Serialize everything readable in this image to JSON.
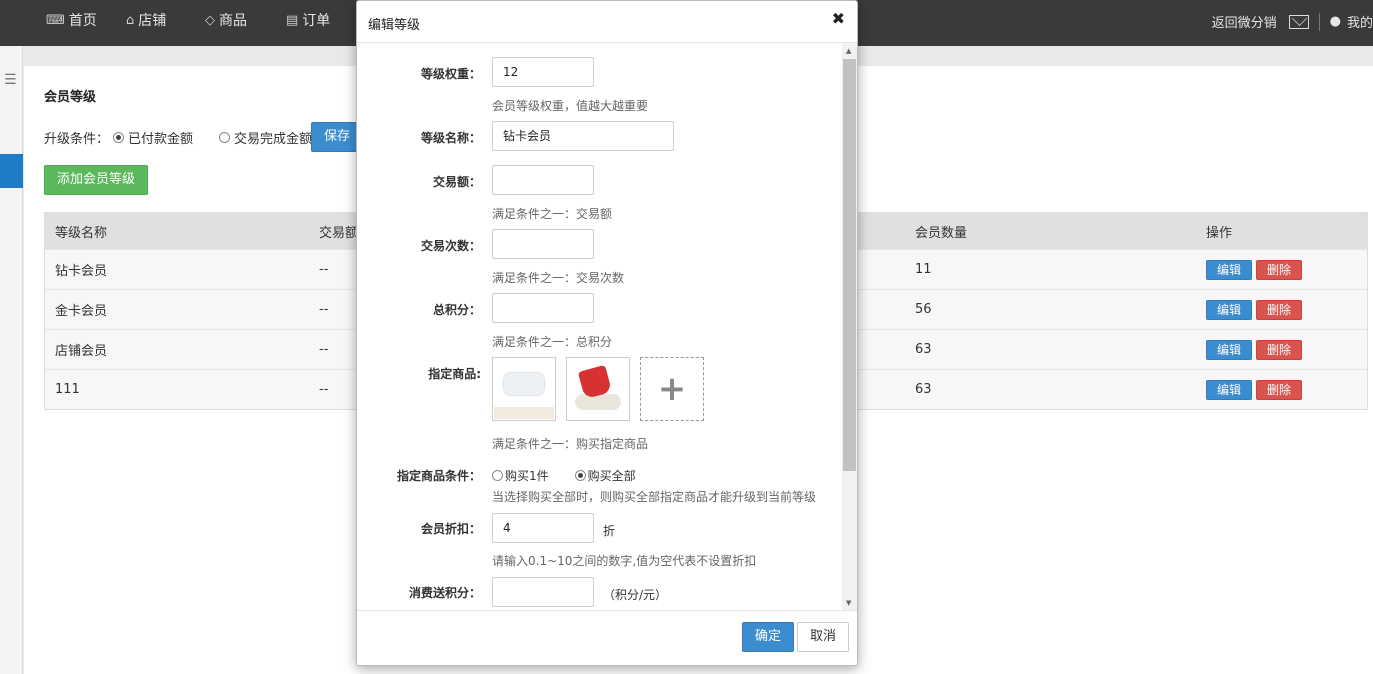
{
  "nav": {
    "items": [
      {
        "icon": "chat-icon",
        "glyph": "⌨",
        "label": "首页"
      },
      {
        "icon": "home-icon",
        "glyph": "⌂",
        "label": "店铺"
      },
      {
        "icon": "tag-icon",
        "glyph": "◇",
        "label": "商品"
      },
      {
        "icon": "list-icon",
        "glyph": "▤",
        "label": "订单"
      }
    ],
    "back_link": "返回微分销",
    "user_label": "我的"
  },
  "page": {
    "title": "会员等级",
    "upgrade_label": "升级条件：",
    "option_paid": "已付款金额",
    "option_completed": "交易完成金额",
    "save_label": "保存",
    "add_label": "添加会员等级"
  },
  "table": {
    "headers": [
      "等级名称",
      "交易额",
      "会员数量",
      "操作"
    ],
    "rows": [
      {
        "name": "钻卡会员",
        "amount": "--",
        "count": "11"
      },
      {
        "name": "金卡会员",
        "amount": "--",
        "count": "56"
      },
      {
        "name": "店铺会员",
        "amount": "--",
        "count": "63"
      },
      {
        "name": "111",
        "amount": "--",
        "count": "63"
      }
    ],
    "edit_label": "编辑",
    "delete_label": "删除"
  },
  "modal": {
    "title": "编辑等级",
    "close_glyph": "✖",
    "fields": {
      "weight_label": "等级权重：",
      "weight_value": "12",
      "weight_help": "会员等级权重，值越大越重要",
      "name_label": "等级名称：",
      "name_value": "钻卡会员",
      "amount_label": "交易额：",
      "amount_value": "",
      "amount_help": "满足条件之一：交易额",
      "times_label": "交易次数：",
      "times_value": "",
      "times_help": "满足条件之一：交易次数",
      "points_label": "总积分：",
      "points_value": "",
      "points_help": "满足条件之一：总积分",
      "goods_label": "指定商品:",
      "goods_help": "满足条件之一：购买指定商品",
      "goods_add_glyph": "+",
      "goods_cond_label": "指定商品条件：",
      "goods_cond_one": "购买1件",
      "goods_cond_all": "购买全部",
      "goods_cond_help": "当选择购买全部时，则购买全部指定商品才能升级到当前等级",
      "discount_label": "会员折扣：",
      "discount_value": "4",
      "discount_unit": "折",
      "discount_help": "请输入0.1~10之间的数字,值为空代表不设置折扣",
      "bonus_label": "消费送积分：",
      "bonus_value": "",
      "bonus_unit": "（积分/元）"
    },
    "ok_label": "确定",
    "cancel_label": "取消"
  }
}
